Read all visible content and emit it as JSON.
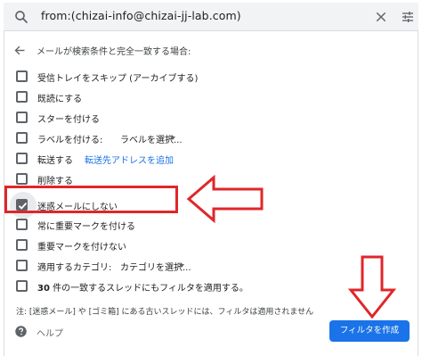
{
  "search": {
    "query": "from:(chizai-info@chizai-jj-lab.com)"
  },
  "heading": "メールが検索条件と完全一致する場合:",
  "options": [
    {
      "label": "受信トレイをスキップ (アーカイブする)",
      "checked": false
    },
    {
      "label": "既読にする",
      "checked": false
    },
    {
      "label": "スターを付ける",
      "checked": false
    },
    {
      "label": "ラベルを付ける:",
      "dropdown": "ラベルを選択...",
      "checked": false
    },
    {
      "label": "転送する",
      "link": "転送先アドレスを追加",
      "checked": false
    },
    {
      "label": "削除する",
      "checked": false
    },
    {
      "label": "迷惑メールにしない",
      "checked": true
    },
    {
      "label": "常に重要マークを付ける",
      "checked": false
    },
    {
      "label": "重要マークを付けない",
      "checked": false
    },
    {
      "label": "適用するカテゴリ:",
      "dropdown": "カテゴリを選択...",
      "checked": false
    },
    {
      "label_bold": "30",
      "label_rest": " 件の一致するスレッドにもフィルタを適用する。",
      "checked": false
    }
  ],
  "note": "注: [迷惑メール] や [ゴミ箱] にある古いスレッドには、フィルタは適用されません",
  "help_label": "ヘルプ",
  "create_button": "フィルタを作成",
  "colors": {
    "accent": "#1a73e8",
    "annotation_red": "#e0262a",
    "search_bg": "#f1f3f4"
  },
  "icons": {
    "search": "search-icon",
    "clear": "close-icon",
    "tune": "tune-icon",
    "back": "arrow-back-icon",
    "help": "help-icon"
  }
}
